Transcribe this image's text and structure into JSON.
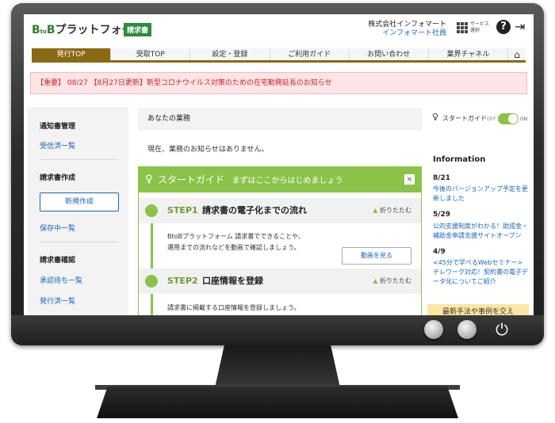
{
  "header": {
    "logo_b1": "B",
    "logo_to": "to",
    "logo_b2": "B",
    "logo_rest": "プラットフォーム",
    "badge": "請求書",
    "company": "株式会社インフォマート",
    "user": "インフォマート社員",
    "service_label_1": "サービス",
    "service_label_2": "選択"
  },
  "nav": {
    "items": [
      "発行TOP",
      "受取TOP",
      "設定・登録",
      "ご利用ガイド",
      "お問い合わせ",
      "業界チャネル"
    ]
  },
  "alert": {
    "text": "【重要】 08/27 【8月27日更新】新型コロナウイルス対策のための在宅勤務延長のお知らせ"
  },
  "sidebar": {
    "section1_head": "通知書管理",
    "section1_link": "受信済一覧",
    "section2_head": "請求書作成",
    "new_button": "新規作成",
    "saved_link": "保存中一覧",
    "section3_head": "請求書確認",
    "approval_link": "承認待ち一覧",
    "issued_link": "発行済一覧"
  },
  "main": {
    "title": "あなたの業務",
    "message": "現在、業務のお知らせはありません。"
  },
  "guide": {
    "title": "スタートガイド",
    "subtitle": "まずはここからはじめましょう",
    "close": "×",
    "fold_label": "折りたたむ",
    "step1_num": "STEP1",
    "step1_title": "請求書の電子化までの流れ",
    "step1_text1": "BtoBプラットフォーム 請求書でできることや、",
    "step1_text2": "運用までの流れなどを動画で確認しましょう。",
    "video_button": "動画を見る",
    "step2_num": "STEP2",
    "step2_title": "口座情報を登録",
    "step2_text": "請求書に掲載する口座情報を登録しましょう。"
  },
  "right": {
    "start_guide_label": "スタートガイド",
    "toggle_off": "OFF",
    "toggle_on": "ON",
    "toggle_state": "on",
    "info_head": "Information",
    "news": [
      {
        "date": "8/21",
        "text": "今後のバージョンアップ予定を更新しました"
      },
      {
        "date": "5/29",
        "text": "公的支援制度がわかる！助成金・補助金申請支援サイトオープン"
      },
      {
        "date": "4/9",
        "text": "<45分で学べるWebセミナー>テレワーク対応！契約書の電子データ化についてご紹介"
      }
    ],
    "promo": "最新手法や事例を交え"
  },
  "colors": {
    "accent_green": "#8bc34a",
    "nav_brown": "#8b6914",
    "link_blue": "#1565c0",
    "alert_red": "#c62828"
  }
}
